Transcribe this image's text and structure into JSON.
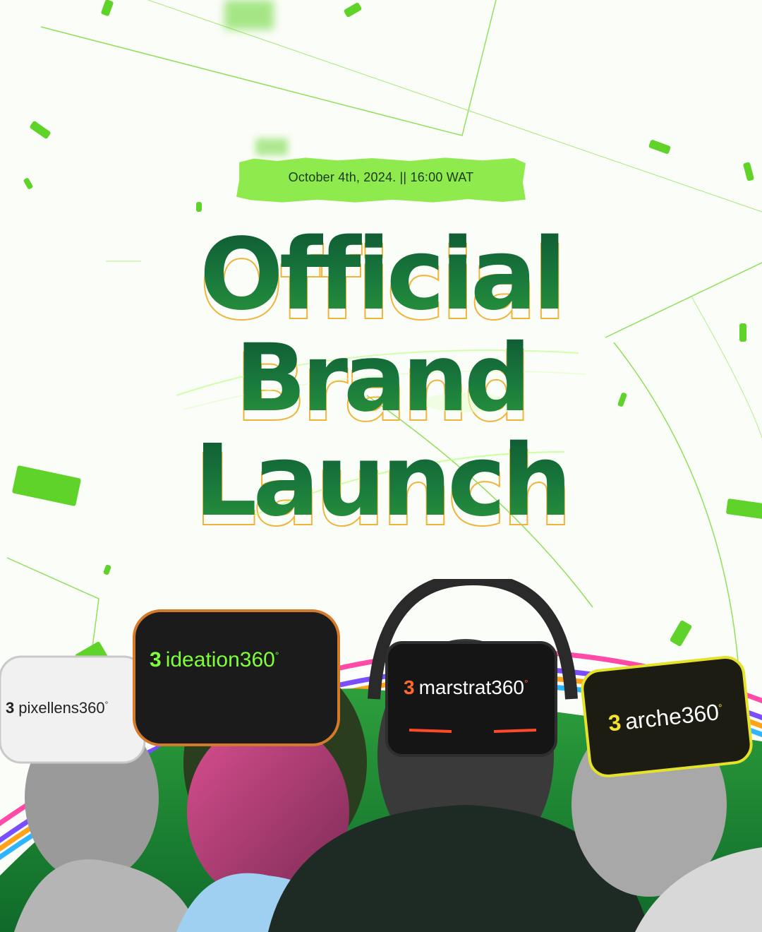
{
  "event": {
    "date_time": "October 4th, 2024.  || 16:00 WAT"
  },
  "headline": {
    "line1": "Official",
    "line2": "Brand",
    "line3": "Launch"
  },
  "brands": {
    "mark": "3",
    "pixellens": "pixellens360",
    "ideation": "ideation360",
    "marstrat": "marstrat360",
    "arche": "arche360",
    "trademark": "°"
  },
  "colors": {
    "accent_green": "#8fea4d",
    "headline_green": "#0f5a35",
    "outline_orange": "#f0b43a",
    "confetti_green": "#5fd32a"
  }
}
